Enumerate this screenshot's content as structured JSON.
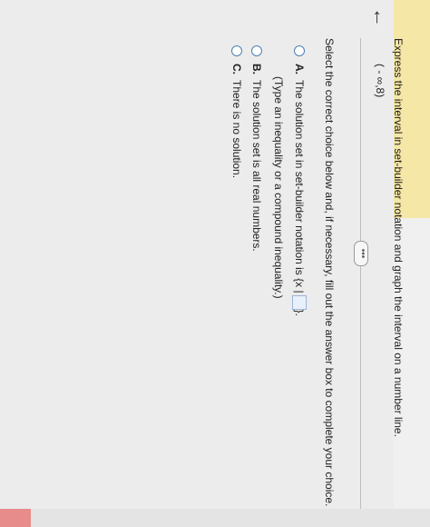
{
  "header": {
    "back_symbol": "←"
  },
  "question": {
    "prompt": "Express the interval in set-builder notation and graph the interval on a number line.",
    "interval": "( - ∞,8)"
  },
  "more_button": "•••",
  "instructions": "Select the correct choice below and, if necessary, fill out the answer box to complete your choice.",
  "choices": [
    {
      "letter": "A.",
      "text": "The solution set in set-builder notation is {x |",
      "suffix": "}.",
      "note": "(Type an inequality or a compound inequality.)"
    },
    {
      "letter": "B.",
      "text": "The solution set is all real numbers."
    },
    {
      "letter": "C.",
      "text": "There is no solution."
    }
  ],
  "colors": {
    "header_accent": "#f5e7a6",
    "radio_border": "#4a7fb5",
    "answer_box_fill": "#e8f0fb"
  }
}
